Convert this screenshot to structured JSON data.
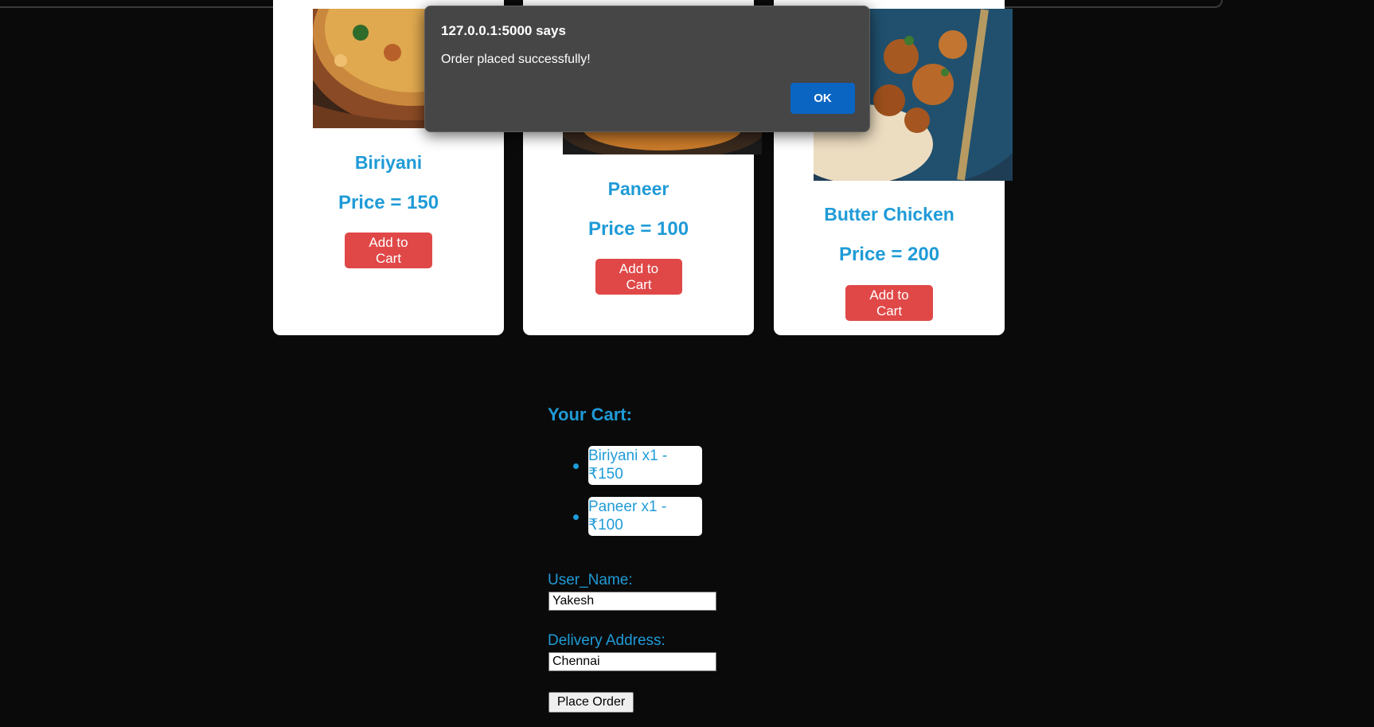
{
  "dialog": {
    "title": "127.0.0.1:5000 says",
    "message": "Order placed successfully!",
    "ok_label": "OK"
  },
  "menu": {
    "items": [
      {
        "name": "Biriyani",
        "price": "Price = 150",
        "add_label": "Add to Cart"
      },
      {
        "name": "Paneer",
        "price": "Price = 100",
        "add_label": "Add to Cart"
      },
      {
        "name": "Butter Chicken",
        "price": "Price = 200",
        "add_label": "Add to Cart"
      }
    ]
  },
  "cart": {
    "title": "Your Cart:",
    "items": [
      "Biriyani x1 - ₹150",
      "Paneer x1 - ₹100"
    ]
  },
  "form": {
    "name_label": "User_Name:",
    "name_value": "Yakesh",
    "address_label": "Delivery Address:",
    "address_value": "Chennai",
    "submit_label": "Place Order"
  },
  "colors": {
    "accent": "#1f9bd7",
    "button": "#e04848",
    "background": "#0a0a0a",
    "dialog_bg": "#464646",
    "dialog_ok": "#0a65c2"
  }
}
